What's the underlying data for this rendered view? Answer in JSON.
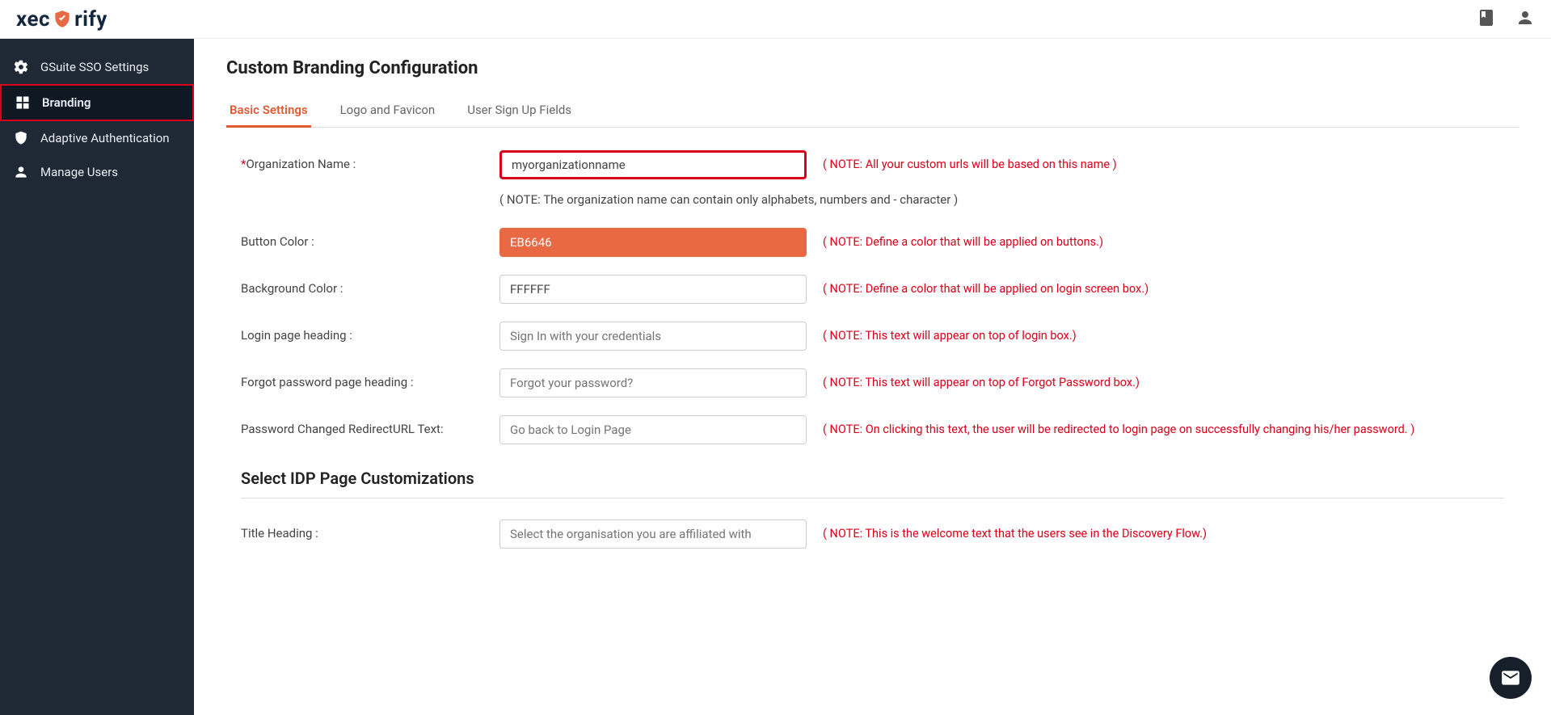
{
  "logo_text_pre": "xec",
  "logo_text_post": "rify",
  "sidebar": {
    "items": [
      {
        "label": "GSuite SSO Settings"
      },
      {
        "label": "Branding"
      },
      {
        "label": "Adaptive Authentication"
      },
      {
        "label": "Manage Users"
      }
    ]
  },
  "page": {
    "title": "Custom Branding Configuration"
  },
  "tabs": [
    {
      "label": "Basic Settings"
    },
    {
      "label": "Logo and Favicon"
    },
    {
      "label": "User Sign Up Fields"
    }
  ],
  "fields": {
    "org_name": {
      "label": "Organization Name :",
      "value": "myorganizationname",
      "note": "( NOTE: All your custom urls will be based on this name )",
      "subnote": "( NOTE: The organization name can contain only alphabets, numbers and - character )"
    },
    "btn_color": {
      "label": "Button Color :",
      "value": "EB6646",
      "note": "( NOTE: Define a color that will be applied on buttons.)"
    },
    "bg_color": {
      "label": "Background Color :",
      "value": "FFFFFF",
      "note": "( NOTE: Define a color that will be applied on login screen box.)"
    },
    "login_head": {
      "label": "Login page heading :",
      "placeholder": "Sign In with your credentials",
      "note": "( NOTE: This text will appear on top of login box.)"
    },
    "forgot_head": {
      "label": "Forgot password page heading :",
      "placeholder": "Forgot your password?",
      "note": "( NOTE: This text will appear on top of Forgot Password box.)"
    },
    "pwd_redirect": {
      "label": "Password Changed RedirectURL Text:",
      "placeholder": "Go back to Login Page",
      "note": "( NOTE: On clicking this text, the user will be redirected to login page on successfully changing his/her password. )"
    },
    "idp_section": "Select IDP Page Customizations",
    "title_head": {
      "label": "Title Heading :",
      "placeholder": "Select the organisation you are affiliated with",
      "note": "( NOTE: This is the welcome text that the users see in the Discovery Flow.)"
    }
  }
}
